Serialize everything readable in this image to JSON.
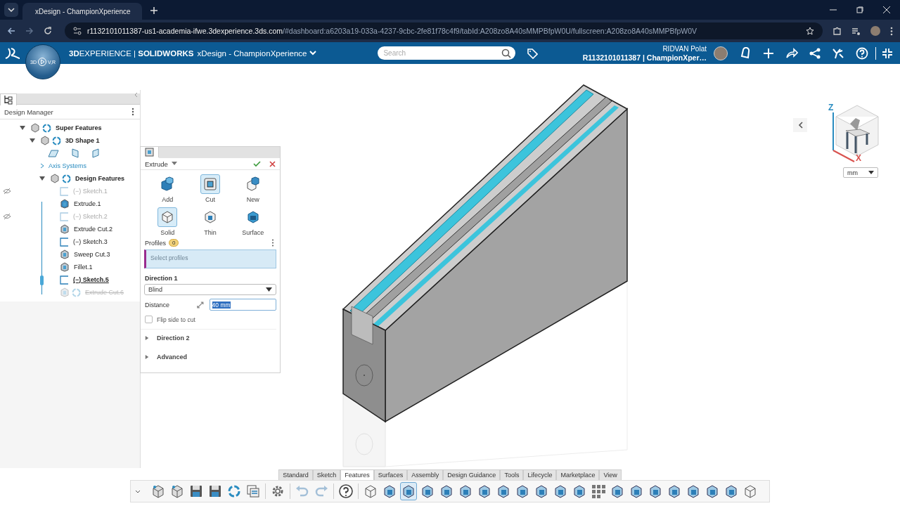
{
  "browser": {
    "tab_title": "xDesign - ChampionXperience",
    "url_host": "r1132101011387-us1-academia-ifwe.3dexperience.3ds.com",
    "url_path": "/#dashboard:a6203a19-033a-4237-9cbc-2fe81f78c4f9/tabId:A208zo8A40sMMPBfpW0U/fullscreen:A208zo8A40sMMPBfpW0V"
  },
  "app_header": {
    "brand": "**3D**EXPERIENCE | **SOLIDWORKS**",
    "app_name": "xDesign - ChampionXperience",
    "compass_labels": [
      "3D",
      "V,R"
    ],
    "search": {
      "placeholder": "Search"
    },
    "user_name": "RIDVAN Polat",
    "tenant": "R1132101011387 | ChampionXper…"
  },
  "design_manager": {
    "title": "Design Manager",
    "tree": [
      {
        "kind": "group",
        "label": "Super Features",
        "expanded": true,
        "children": [
          {
            "kind": "shape",
            "label": "3D Shape 1",
            "expanded": true,
            "children": [
              {
                "kind": "planes"
              },
              {
                "kind": "axes",
                "label": "Axis Systems",
                "expanded": false
              },
              {
                "kind": "group",
                "label": "Design Features",
                "expanded": true,
                "children": [
                  {
                    "kind": "sketch",
                    "label": "(−)  Sketch.1",
                    "hidden": true,
                    "editing": false,
                    "rolled_back": false
                  },
                  {
                    "kind": "extrude",
                    "label": "Extrude.1",
                    "hidden": false,
                    "editing": false,
                    "rolled_back": false
                  },
                  {
                    "kind": "sketch",
                    "label": "(−)  Sketch.2",
                    "hidden": true,
                    "editing": false,
                    "rolled_back": false
                  },
                  {
                    "kind": "cut",
                    "label": "Extrude Cut.2",
                    "hidden": false,
                    "editing": false,
                    "rolled_back": false
                  },
                  {
                    "kind": "sketch",
                    "label": "(−)  Sketch.3",
                    "hidden": false,
                    "editing": false,
                    "rolled_back": false
                  },
                  {
                    "kind": "sweep",
                    "label": "Sweep Cut.3",
                    "hidden": false,
                    "editing": false,
                    "rolled_back": false
                  },
                  {
                    "kind": "fillet",
                    "label": "Fillet.1",
                    "hidden": false,
                    "editing": false,
                    "rolled_back": false
                  },
                  {
                    "kind": "sketch",
                    "label": "(−)  Sketch.5",
                    "hidden": false,
                    "editing": true,
                    "rolled_back": false
                  },
                  {
                    "kind": "cut",
                    "label": "Extrude Cut.6",
                    "hidden": false,
                    "editing": false,
                    "rolled_back": true
                  }
                ]
              }
            ]
          }
        ]
      }
    ]
  },
  "extrude_panel": {
    "title": "Extrude",
    "operations": [
      {
        "kind": "add",
        "label": "Add",
        "selected": false
      },
      {
        "kind": "cut",
        "label": "Cut",
        "selected": true
      },
      {
        "kind": "new",
        "label": "New",
        "selected": false
      }
    ],
    "body_types": [
      {
        "kind": "solid",
        "label": "Solid",
        "selected": true
      },
      {
        "kind": "thin",
        "label": "Thin",
        "selected": false
      },
      {
        "kind": "surface",
        "label": "Surface",
        "selected": false
      }
    ],
    "profiles": {
      "label": "Profiles",
      "count": "0",
      "placeholder": "Select profiles"
    },
    "direction_1": {
      "label": "Direction 1",
      "end_condition": "Blind",
      "distance_label": "Distance",
      "distance": "40 mm"
    },
    "flip": {
      "label": "Flip side to cut",
      "checked": false
    },
    "sections": [
      {
        "label": "Direction 2",
        "expanded": false
      },
      {
        "label": "Advanced",
        "expanded": false
      }
    ]
  },
  "view_cube": {
    "axis_z": "Z",
    "axis_x": "X",
    "units": "mm"
  },
  "toolbar": {
    "tabs": [
      {
        "label": "Standard",
        "selected": false
      },
      {
        "label": "Sketch",
        "selected": false
      },
      {
        "label": "Features",
        "selected": true
      },
      {
        "label": "Surfaces",
        "selected": false
      },
      {
        "label": "Assembly",
        "selected": false
      },
      {
        "label": "Design Guidance",
        "selected": false
      },
      {
        "label": "Tools",
        "selected": false
      },
      {
        "label": "Lifecycle",
        "selected": false
      },
      {
        "label": "Marketplace",
        "selected": false
      },
      {
        "label": "View",
        "selected": false
      }
    ],
    "tools": [
      {
        "kind": "part",
        "selected": false,
        "disabled": false
      },
      {
        "kind": "part",
        "selected": false,
        "disabled": false
      },
      {
        "kind": "save",
        "selected": false,
        "disabled": false
      },
      {
        "kind": "save",
        "selected": false,
        "disabled": false
      },
      {
        "kind": "sync",
        "selected": false,
        "disabled": false
      },
      {
        "kind": "list",
        "selected": false,
        "disabled": false
      },
      {
        "kind": "separator"
      },
      {
        "kind": "gear",
        "selected": false,
        "disabled": false
      },
      {
        "kind": "separator"
      },
      {
        "kind": "undo",
        "selected": false,
        "disabled": true
      },
      {
        "kind": "redo",
        "selected": false,
        "disabled": true
      },
      {
        "kind": "separator"
      },
      {
        "kind": "help",
        "selected": false,
        "disabled": false
      },
      {
        "kind": "separator"
      },
      {
        "kind": "cube",
        "selected": false,
        "disabled": false
      },
      {
        "kind": "feature",
        "selected": false,
        "disabled": false
      },
      {
        "kind": "feature",
        "selected": true,
        "disabled": false
      },
      {
        "kind": "feature",
        "selected": false,
        "disabled": false
      },
      {
        "kind": "feature",
        "selected": false,
        "disabled": false
      },
      {
        "kind": "feature",
        "selected": false,
        "disabled": false
      },
      {
        "kind": "feature",
        "selected": false,
        "disabled": false
      },
      {
        "kind": "feature",
        "selected": false,
        "disabled": false
      },
      {
        "kind": "feature",
        "selected": false,
        "disabled": false
      },
      {
        "kind": "feature",
        "selected": false,
        "disabled": false
      },
      {
        "kind": "feature",
        "selected": false,
        "disabled": false
      },
      {
        "kind": "feature",
        "selected": false,
        "disabled": false
      },
      {
        "kind": "grid",
        "selected": false,
        "disabled": false
      },
      {
        "kind": "feature",
        "selected": false,
        "disabled": false
      },
      {
        "kind": "feature",
        "selected": false,
        "disabled": false
      },
      {
        "kind": "feature",
        "selected": false,
        "disabled": false
      },
      {
        "kind": "feature",
        "selected": false,
        "disabled": false
      },
      {
        "kind": "feature",
        "selected": false,
        "disabled": false
      },
      {
        "kind": "feature",
        "selected": false,
        "disabled": false
      },
      {
        "kind": "feature",
        "selected": false,
        "disabled": false
      },
      {
        "kind": "cube",
        "selected": false,
        "disabled": false
      }
    ]
  }
}
